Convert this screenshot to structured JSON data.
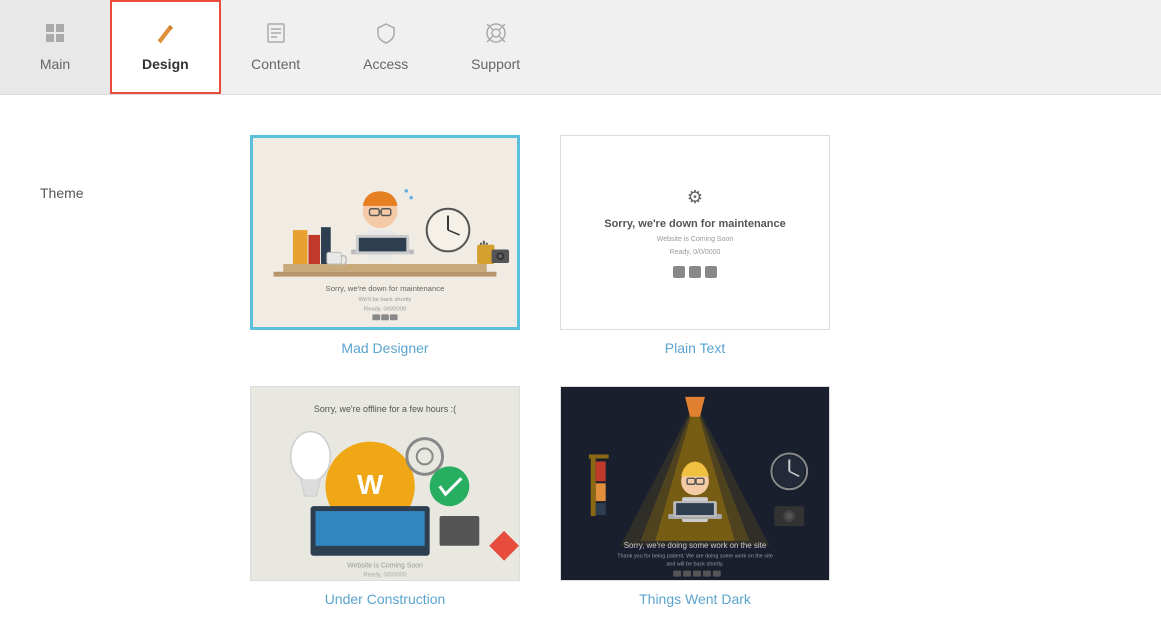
{
  "tabs": [
    {
      "id": "main",
      "label": "Main",
      "icon": "➕",
      "active": false
    },
    {
      "id": "design",
      "label": "Design",
      "icon": "✏️",
      "active": true
    },
    {
      "id": "content",
      "label": "Content",
      "icon": "🗒️",
      "active": false
    },
    {
      "id": "access",
      "label": "Access",
      "icon": "🛡️",
      "active": false
    },
    {
      "id": "support",
      "label": "Support",
      "icon": "⚽",
      "active": false
    }
  ],
  "section": {
    "label": "Theme"
  },
  "themes": [
    {
      "id": "mad-designer",
      "name": "Mad Designer",
      "selected": true
    },
    {
      "id": "plain-text",
      "name": "Plain Text",
      "selected": false
    },
    {
      "id": "under-construction",
      "name": "Under Construction",
      "selected": false
    },
    {
      "id": "things-went-dark",
      "name": "Things Went Dark",
      "selected": false
    }
  ],
  "mad_designer": {
    "sorry_text": "Sorry, we're down for maintenance",
    "sub_text": "We'll be back shortly"
  },
  "plain_text": {
    "sorry_text": "Sorry, we're down for maintenance",
    "website_text": "Website is Coming Soon",
    "date_text": "Ready, 0/0/0000"
  },
  "under_construction": {
    "sorry_text": "Sorry, we're offline for a few hours :("
  },
  "things_went_dark": {
    "sorry_text": "Sorry, we're doing some work on the site",
    "sub_text": "Thank you for being patient. We are doing some work on the site and will be back shortly."
  }
}
